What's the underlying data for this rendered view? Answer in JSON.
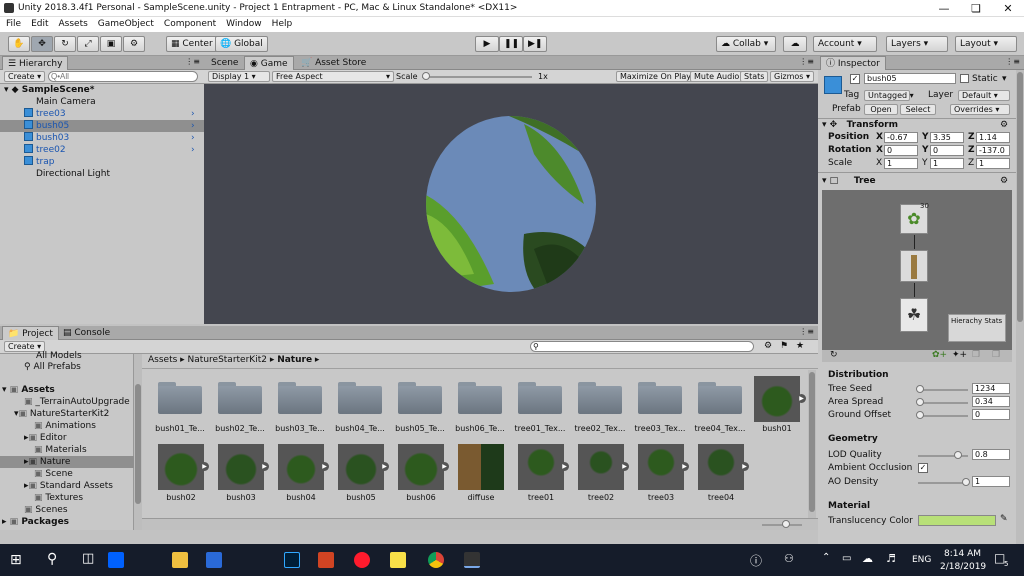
{
  "window": {
    "title": "Unity 2018.3.4f1 Personal - SampleScene.unity - Project 1 Entrapment - PC, Mac & Linux Standalone* <DX11>"
  },
  "menu": [
    "File",
    "Edit",
    "Assets",
    "GameObject",
    "Component",
    "Window",
    "Help"
  ],
  "toolbar": {
    "center": "Center",
    "global": "Global",
    "collab": "Collab",
    "account": "Account",
    "layers": "Layers",
    "layout": "Layout"
  },
  "hierarchy": {
    "tab": "Hierarchy",
    "create": "Create",
    "search_placeholder": "Q•All",
    "scene": "SampleScene*",
    "items": [
      "Main Camera",
      "tree03",
      "bush05",
      "bush03",
      "tree02",
      "trap",
      "Directional Light"
    ]
  },
  "game": {
    "tabs": [
      "Scene",
      "Game",
      "Asset Store"
    ],
    "display": "Display 1",
    "aspect": "Free Aspect",
    "scale_label": "Scale",
    "scale_value": "1x",
    "maximize": "Maximize On Play",
    "mute": "Mute Audio",
    "stats": "Stats",
    "gizmos": "Gizmos"
  },
  "project": {
    "tabs": [
      "Project",
      "Console"
    ],
    "create": "Create",
    "tree": [
      "All Models",
      "All Prefabs",
      "Assets",
      "_TerrainAutoUpgrade",
      "NatureStarterKit2",
      "Animations",
      "Editor",
      "Materials",
      "Nature",
      "Scene",
      "Standard Assets",
      "Textures",
      "Scenes",
      "Packages"
    ],
    "breadcrumb": [
      "Assets",
      "NatureStarterKit2",
      "Nature"
    ],
    "row1": [
      "bush01_Te...",
      "bush02_Te...",
      "bush03_Te...",
      "bush04_Te...",
      "bush05_Te...",
      "bush06_Te...",
      "tree01_Tex...",
      "tree02_Tex...",
      "tree03_Tex...",
      "tree04_Tex...",
      "bush01"
    ],
    "row2": [
      "bush02",
      "bush03",
      "bush04",
      "bush05",
      "bush06",
      "diffuse",
      "tree01",
      "tree02",
      "tree03",
      "tree04"
    ]
  },
  "inspector": {
    "tab": "Inspector",
    "name": "bush05",
    "static": "Static",
    "tag_label": "Tag",
    "tag": "Untagged",
    "layer_label": "Layer",
    "layer": "Default",
    "prefab_label": "Prefab",
    "open": "Open",
    "select": "Select",
    "overrides": "Overrides",
    "transform": "Transform",
    "position": {
      "label": "Position",
      "x": "-0.67",
      "y": "3.35",
      "z": "1.14"
    },
    "rotation": {
      "label": "Rotation",
      "x": "0",
      "y": "0",
      "z": "-137.0"
    },
    "scale": {
      "label": "Scale",
      "x": "1",
      "y": "1",
      "z": "1"
    },
    "tree": "Tree",
    "node_count": "30",
    "hierarchy_stats": "Hierachy Stats",
    "distribution": "Distribution",
    "tree_seed": {
      "label": "Tree Seed",
      "value": "1234"
    },
    "area_spread": {
      "label": "Area Spread",
      "value": "0.34"
    },
    "ground_offset": {
      "label": "Ground Offset",
      "value": "0"
    },
    "geometry": "Geometry",
    "lod_quality": {
      "label": "LOD Quality",
      "value": "0.8"
    },
    "ambient_occlusion": "Ambient Occlusion",
    "ao_density": {
      "label": "AO Density",
      "value": "1"
    },
    "material": "Material",
    "translucency": "Translucency Color",
    "translucency_color": "#b8e078"
  },
  "taskbar": {
    "lang": "ENG",
    "time": "8:14 AM",
    "date": "2/18/2019",
    "notif": "5"
  }
}
